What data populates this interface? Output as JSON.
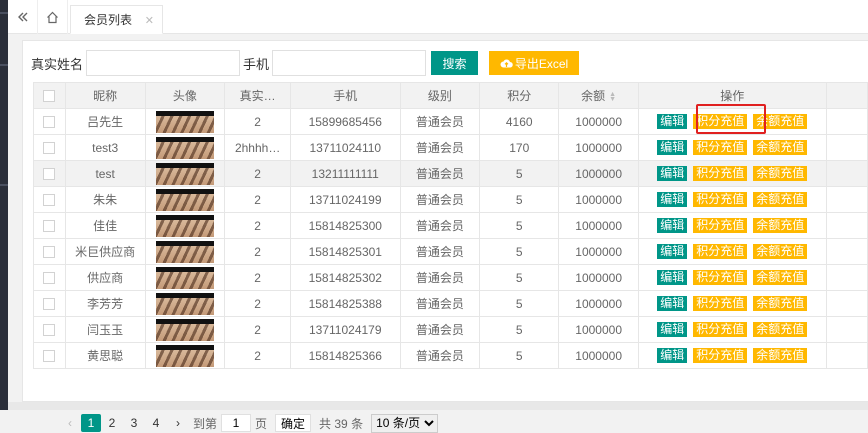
{
  "tabs": {
    "collapse_icon": "double-chevron-left-icon",
    "home_icon": "home-icon",
    "active": "会员列表",
    "close_icon": "close-icon"
  },
  "toolbar": {
    "name_label": "真实姓名",
    "name_value": "",
    "phone_label": "手机",
    "phone_value": "",
    "search_label": "搜索",
    "export_label": "导出Excel"
  },
  "table": {
    "headers": {
      "nickname": "昵称",
      "avatar": "头像",
      "realname": "真实…",
      "phone": "手机",
      "level": "级别",
      "points": "积分",
      "balance": "余额",
      "actions": "操作"
    },
    "action_labels": {
      "edit": "编辑",
      "points": "积分充值",
      "balance": "余额充值"
    },
    "rows": [
      {
        "nickname": "吕先生",
        "realname": "2",
        "phone": "15899685456",
        "level": "普通会员",
        "points": "4160",
        "balance": "1000000"
      },
      {
        "nickname": "test3",
        "realname": "2hhhh…",
        "phone": "13711024110",
        "level": "普通会员",
        "points": "170",
        "balance": "1000000"
      },
      {
        "nickname": "test",
        "realname": "2",
        "phone": "13211111111",
        "level": "普通会员",
        "points": "5",
        "balance": "1000000"
      },
      {
        "nickname": "朱朱",
        "realname": "2",
        "phone": "13711024199",
        "level": "普通会员",
        "points": "5",
        "balance": "1000000"
      },
      {
        "nickname": "佳佳",
        "realname": "2",
        "phone": "15814825300",
        "level": "普通会员",
        "points": "5",
        "balance": "1000000"
      },
      {
        "nickname": "米巨供应商",
        "realname": "2",
        "phone": "15814825301",
        "level": "普通会员",
        "points": "5",
        "balance": "1000000"
      },
      {
        "nickname": "供应商",
        "realname": "2",
        "phone": "15814825302",
        "level": "普通会员",
        "points": "5",
        "balance": "1000000"
      },
      {
        "nickname": "李芳芳",
        "realname": "2",
        "phone": "15814825388",
        "level": "普通会员",
        "points": "5",
        "balance": "1000000"
      },
      {
        "nickname": "闫玉玉",
        "realname": "2",
        "phone": "13711024179",
        "level": "普通会员",
        "points": "5",
        "balance": "1000000"
      },
      {
        "nickname": "黄思聪",
        "realname": "2",
        "phone": "15814825366",
        "level": "普通会员",
        "points": "5",
        "balance": "1000000"
      }
    ]
  },
  "pagination": {
    "pages": [
      "1",
      "2",
      "3",
      "4"
    ],
    "current_page": "1",
    "goto_label": "到第",
    "goto_value": "1",
    "page_unit": "页",
    "confirm_label": "确定",
    "total_text": "共 39 条",
    "page_size_option": "10 条/页"
  },
  "colors": {
    "primary": "#009688",
    "warning": "#ffb800",
    "highlight": "#e02020"
  }
}
